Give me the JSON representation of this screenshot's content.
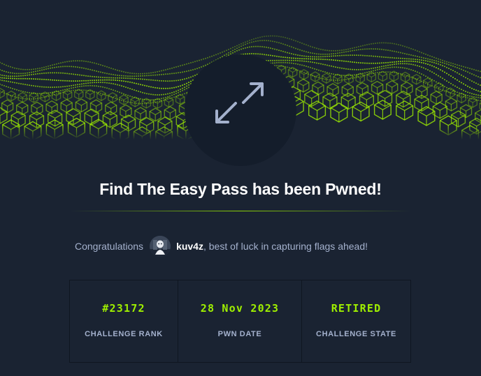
{
  "colors": {
    "background": "#1a2332",
    "accent": "#9fef00",
    "muted_text": "#a4b1cd",
    "circle": "#141d2b"
  },
  "banner": {
    "icon": "expand-arrows-icon"
  },
  "title": "Find The Easy Pass has been Pwned!",
  "congrats": {
    "prefix": "Congratulations",
    "avatar_icon": "user-avatar",
    "username": "kuv4z",
    "suffix": ", best of luck in capturing flags ahead!"
  },
  "stats": [
    {
      "value": "#23172",
      "label": "CHALLENGE RANK"
    },
    {
      "value": "28 Nov 2023",
      "label": "PWN DATE"
    },
    {
      "value": "RETIRED",
      "label": "CHALLENGE STATE"
    }
  ]
}
